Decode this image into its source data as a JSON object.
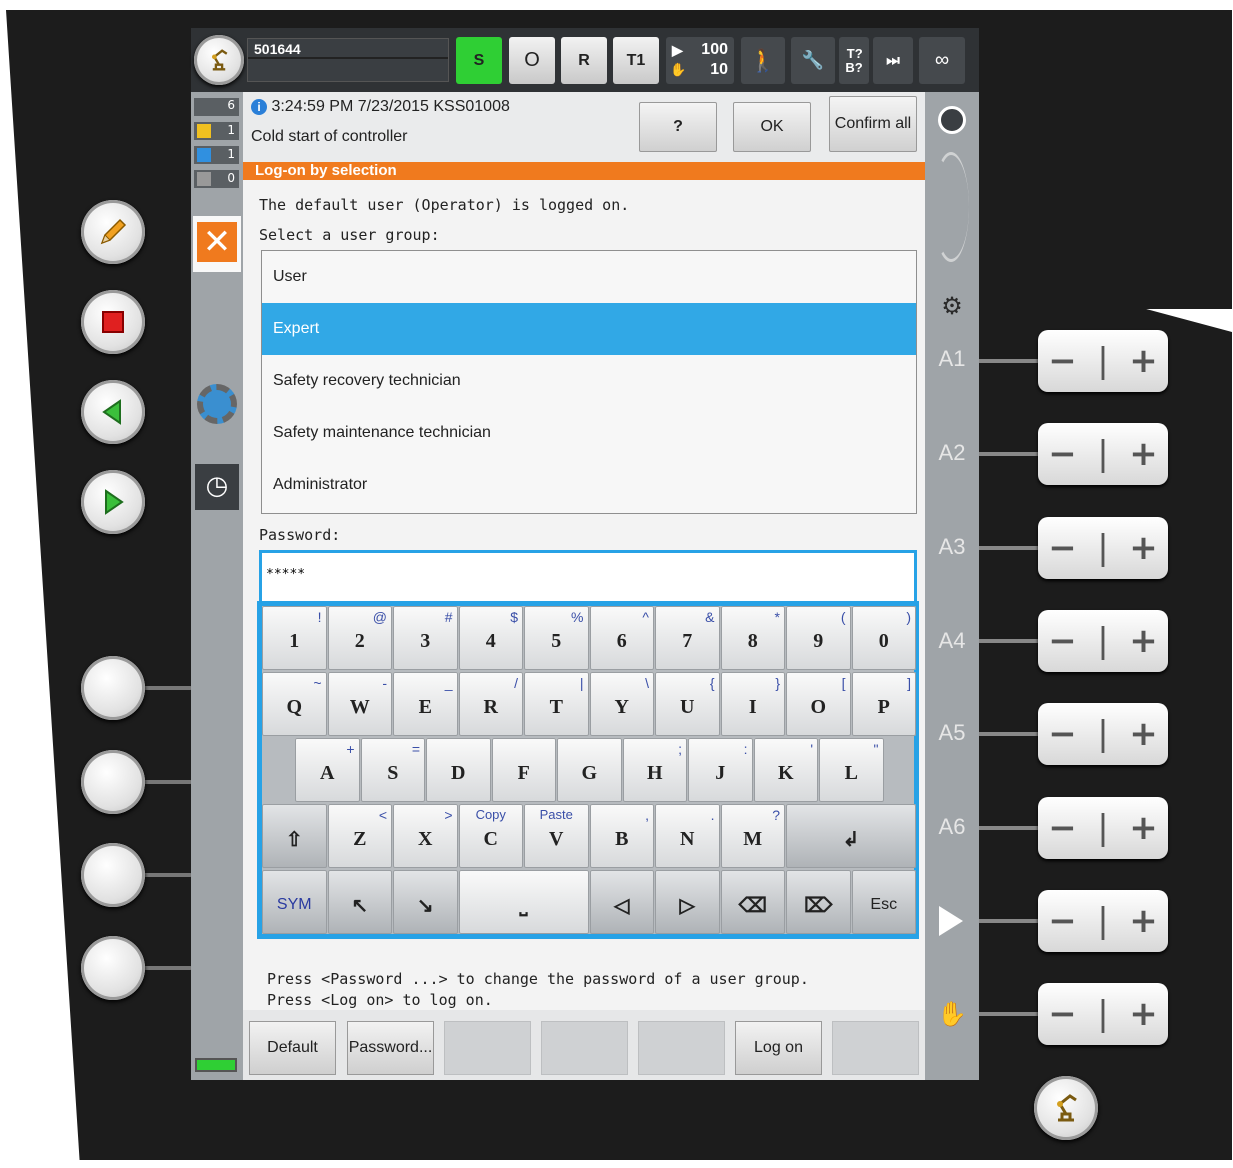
{
  "topbar": {
    "robot_name": "501644",
    "s": "S",
    "o": "O",
    "r": "R",
    "mode": "T1",
    "override_top": "100",
    "override_bottom": "10",
    "tool_base": "T?\nB?",
    "infinity": "∞"
  },
  "counters": [
    {
      "value": "6"
    },
    {
      "value": "1"
    },
    {
      "value": "1"
    },
    {
      "value": "0"
    }
  ],
  "message": {
    "time": "3:24:59 PM 7/23/2015 KSS01008",
    "text": "Cold start of controller",
    "help": "?",
    "ok": "OK",
    "confirm_all": "Confirm all"
  },
  "dialog": {
    "title": "Log-on by selection",
    "info": "The default user (Operator) is logged on.",
    "prompt": "Select a user group:",
    "groups": [
      "User",
      "Expert",
      "Safety recovery technician",
      "Safety maintenance technician",
      "Administrator"
    ],
    "selected_index": 1,
    "password_label": "Password:",
    "password_value": "*****",
    "hint1": "Press <Password ...> to change the password of a user group.",
    "hint2": "Press <Log on> to log on."
  },
  "keyboard": {
    "row1": [
      [
        "1",
        "!"
      ],
      [
        "2",
        "@"
      ],
      [
        "3",
        "#"
      ],
      [
        "4",
        "$"
      ],
      [
        "5",
        "%"
      ],
      [
        "6",
        "^"
      ],
      [
        "7",
        "&"
      ],
      [
        "8",
        "*"
      ],
      [
        "9",
        "("
      ],
      [
        "0",
        ")"
      ]
    ],
    "row2": [
      [
        "Q",
        "~"
      ],
      [
        "W",
        "-"
      ],
      [
        "E",
        "_"
      ],
      [
        "R",
        "/"
      ],
      [
        "T",
        "|"
      ],
      [
        "Y",
        "\\"
      ],
      [
        "U",
        "{"
      ],
      [
        "I",
        "}"
      ],
      [
        "O",
        "["
      ],
      [
        "P",
        "]"
      ]
    ],
    "row3": [
      [
        "A",
        "+"
      ],
      [
        "S",
        "="
      ],
      [
        "D",
        ""
      ],
      [
        "F",
        ""
      ],
      [
        "G",
        ""
      ],
      [
        "H",
        ";"
      ],
      [
        "J",
        ":"
      ],
      [
        "K",
        "'"
      ],
      [
        "L",
        "\""
      ]
    ],
    "row4": [
      [
        "Z",
        "<"
      ],
      [
        "X",
        ">"
      ],
      [
        "C",
        "Copy"
      ],
      [
        "V",
        "Paste"
      ],
      [
        "B",
        ","
      ],
      [
        "N",
        "."
      ],
      [
        "M",
        "?"
      ]
    ],
    "sym": "SYM",
    "esc": "Esc"
  },
  "axes": [
    "A1",
    "A2",
    "A3",
    "A4",
    "A5",
    "A6"
  ],
  "softkeys": {
    "default": "Default",
    "password": "Password...",
    "logon": "Log on"
  },
  "colors": {
    "accent": "#27a2e6",
    "selection": "#31a8e6",
    "dialog_bar": "#f07a1e",
    "run_green": "#2fcf34"
  }
}
